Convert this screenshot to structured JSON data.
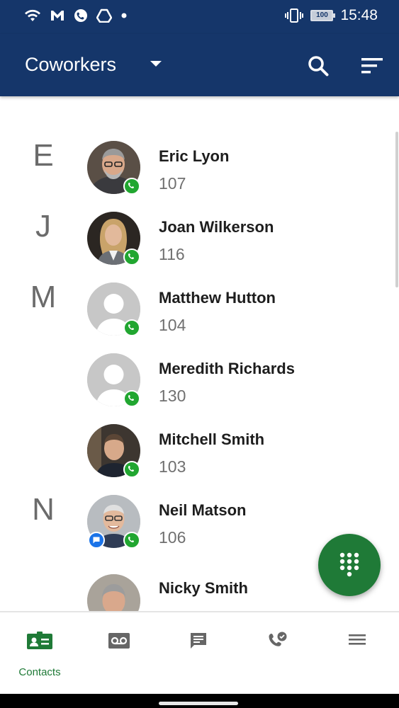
{
  "status_bar": {
    "time": "15:48",
    "battery": "100",
    "icons": [
      "wifi-icon",
      "gmail-icon",
      "call-app-icon",
      "drive-icon",
      "dot-icon",
      "vibrate-icon",
      "battery-icon"
    ]
  },
  "app_bar": {
    "title": "Coworkers",
    "icons": [
      "dropdown-caret-icon",
      "search-icon",
      "sort-icon"
    ],
    "background": "#15366a"
  },
  "contacts": [
    {
      "letter": "E",
      "name": "Eric Lyon",
      "ext": "107",
      "avatar": "photo",
      "presence": "phone"
    },
    {
      "letter": "J",
      "name": "Joan Wilkerson",
      "ext": "116",
      "avatar": "photo",
      "presence": "phone"
    },
    {
      "letter": "M",
      "name": "Matthew Hutton",
      "ext": "104",
      "avatar": "placeholder",
      "presence": "phone"
    },
    {
      "letter": "",
      "name": "Meredith Richards",
      "ext": "130",
      "avatar": "placeholder",
      "presence": "phone"
    },
    {
      "letter": "",
      "name": "Mitchell Smith",
      "ext": "103",
      "avatar": "photo",
      "presence": "phone"
    },
    {
      "letter": "N",
      "name": "Neil Matson",
      "ext": "106",
      "avatar": "photo",
      "presence": "phone",
      "message": true
    },
    {
      "letter": "",
      "name": "Nicky Smith",
      "ext": "",
      "avatar": "photo",
      "presence": ""
    }
  ],
  "fab": {
    "icon": "dialpad-icon",
    "color": "#1f7a37"
  },
  "bottom_nav": {
    "items": [
      {
        "icon": "contacts-icon",
        "label": "Contacts",
        "active": true
      },
      {
        "icon": "voicemail-icon",
        "label": "",
        "active": false
      },
      {
        "icon": "chat-icon",
        "label": "",
        "active": false
      },
      {
        "icon": "call-history-icon",
        "label": "",
        "active": false
      },
      {
        "icon": "menu-icon",
        "label": "",
        "active": false
      }
    ],
    "accent": "#1f7a37"
  }
}
